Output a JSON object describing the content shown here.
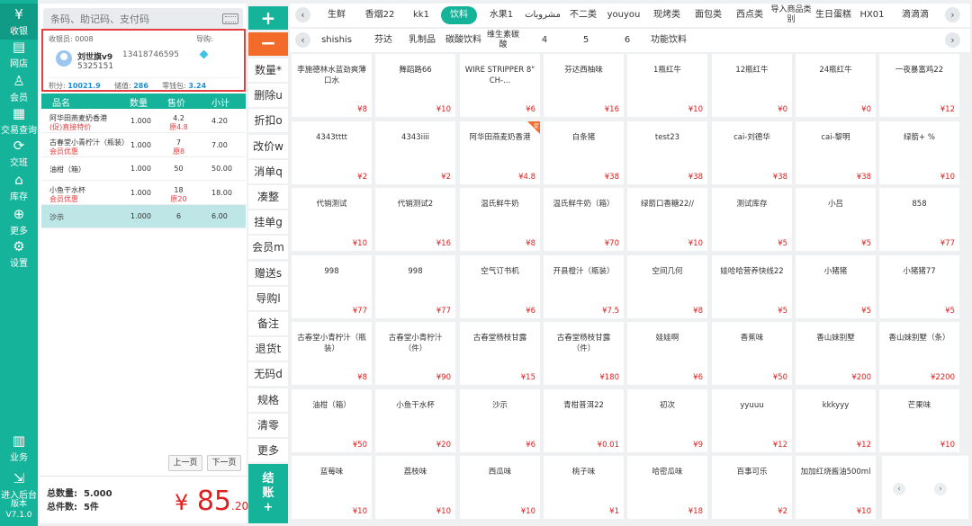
{
  "nav": {
    "items": [
      {
        "label": "收银",
        "icon": "cashier-icon",
        "glyph": "¥"
      },
      {
        "label": "网店",
        "icon": "store-icon",
        "glyph": "▤"
      },
      {
        "label": "会员",
        "icon": "member-icon",
        "glyph": "♙"
      },
      {
        "label": "交易查询",
        "icon": "transactions-icon",
        "glyph": "▦"
      },
      {
        "label": "交班",
        "icon": "shift-icon",
        "glyph": "⟳"
      },
      {
        "label": "库存",
        "icon": "inventory-icon",
        "glyph": "⌂"
      },
      {
        "label": "更多",
        "icon": "more-icon",
        "glyph": "⊕"
      },
      {
        "label": "设置",
        "icon": "settings-icon",
        "glyph": "⚙"
      },
      {
        "label": "业务",
        "icon": "business-icon",
        "glyph": "▥"
      },
      {
        "label": "进入后台",
        "icon": "backend-icon",
        "glyph": "⇲"
      }
    ],
    "version_label": "版本",
    "version": "V7.1.0"
  },
  "search": {
    "placeholder": "条码、助记码、支付码"
  },
  "member": {
    "cashier_label": "收银员: 0008",
    "guide_label": "导购:",
    "name": "刘世旗v9",
    "phone": "13418746595",
    "card": "5325151",
    "points_label": "积分:",
    "points": "10021.9",
    "balance_label": "储值:",
    "balance": "286",
    "change_label": "零钱包:",
    "change": "3.24"
  },
  "cart": {
    "headers": [
      "品名",
      "数量",
      "售价",
      "小计"
    ],
    "rows": [
      {
        "name": "阿华田燕麦奶香港",
        "sub": "(促)直接特价",
        "qty": "1.000",
        "price": "4.2",
        "orig": "原4.8",
        "sum": "4.20"
      },
      {
        "name": "古春堂小青柠汁（瓶装）",
        "sub": "会员优惠",
        "qty": "1.000",
        "price": "7",
        "orig": "原8",
        "sum": "7.00"
      },
      {
        "name": "油柑（箱）",
        "sub": "",
        "qty": "1.000",
        "price": "50",
        "orig": "",
        "sum": "50.00"
      },
      {
        "name": "小鱼干水杯",
        "sub": "会员优惠",
        "qty": "1.000",
        "price": "18",
        "orig": "原20",
        "sum": "18.00"
      },
      {
        "name": "沙示",
        "sub": "",
        "qty": "1.000",
        "price": "6",
        "orig": "",
        "sum": "6.00"
      }
    ],
    "prev_page": "上一页",
    "next_page": "下一页",
    "total_qty_label": "总数量:",
    "total_qty": "5.000",
    "total_items_label": "总件数:",
    "total_items": "5件",
    "grand_currency": "¥",
    "grand_int": "85",
    "grand_dec": ".20"
  },
  "funcs": {
    "add": "+",
    "minus": "−",
    "buttons": [
      "数量*",
      "删除u",
      "折扣o",
      "改价w",
      "消单q",
      "凑整",
      "挂单g",
      "会员m",
      "赠送s",
      "导购l",
      "备注",
      "退货t",
      "无码d",
      "规格",
      "清零",
      "更多"
    ],
    "checkout_1": "结",
    "checkout_2": "账",
    "checkout_3": "+"
  },
  "categories_row1": [
    "生鲜",
    "香烟22",
    "kk1",
    "饮料",
    "水果1",
    "مشروبات",
    "不二类",
    "youyou",
    "现烤类",
    "面包类",
    "西点类",
    "导入商品类别",
    "生日蛋糕",
    "HX01",
    "滴滴滴"
  ],
  "categories_row2": [
    "shishis",
    "芬达",
    "乳制品",
    "碳酸饮料",
    "维生素碳酸",
    "4",
    "5",
    "6",
    "功能饮料"
  ],
  "active_category": "饮料",
  "products": [
    {
      "name": "李施德林水蓝劲爽薄口水",
      "price": "¥8"
    },
    {
      "name": "舞蹈路66",
      "price": "¥10"
    },
    {
      "name": "WIRE STRIPPER 8\" CH-...",
      "price": "¥6"
    },
    {
      "name": "芬达西柚味",
      "price": "¥16"
    },
    {
      "name": "1瓶红牛",
      "price": "¥10"
    },
    {
      "name": "12瓶红牛",
      "price": "¥0"
    },
    {
      "name": "24瓶红牛",
      "price": "¥0"
    },
    {
      "name": "一夜暴富鸡22",
      "price": "¥12"
    },
    {
      "name": "4343tttt",
      "price": "¥2"
    },
    {
      "name": "4343iiii",
      "price": "¥2"
    },
    {
      "name": "阿华田燕麦奶香港",
      "price": "¥4.8",
      "badge": "促"
    },
    {
      "name": "白条猪",
      "price": "¥38"
    },
    {
      "name": "test23",
      "price": "¥38"
    },
    {
      "name": "cai-刘德华",
      "price": "¥38"
    },
    {
      "name": "cai-黎明",
      "price": "¥38"
    },
    {
      "name": "绿箭+ %",
      "price": "¥10"
    },
    {
      "name": "代销测试",
      "price": "¥10"
    },
    {
      "name": "代销测试2",
      "price": "¥16"
    },
    {
      "name": "温氏鲜牛奶",
      "price": "¥8"
    },
    {
      "name": "温氏鲜牛奶（箱）",
      "price": "¥70"
    },
    {
      "name": "绿箭口香糖22//",
      "price": "¥10"
    },
    {
      "name": "测试库存",
      "price": "¥5"
    },
    {
      "name": "小吕",
      "price": "¥5"
    },
    {
      "name": "858",
      "price": "¥77"
    },
    {
      "name": "998",
      "price": "¥77"
    },
    {
      "name": "998",
      "price": "¥77"
    },
    {
      "name": "空气订书机",
      "price": "¥6"
    },
    {
      "name": "开县橙汁（瓶装）",
      "price": "¥7.5"
    },
    {
      "name": "空间几何",
      "price": "¥8"
    },
    {
      "name": "娃哈哈营养快线22",
      "price": "¥5"
    },
    {
      "name": "小猪猪",
      "price": "¥5"
    },
    {
      "name": "小猪猪77",
      "price": "¥5"
    },
    {
      "name": "古春堂小青柠汁（瓶装）",
      "price": "¥8"
    },
    {
      "name": "古春堂小青柠汁（件）",
      "price": "¥90"
    },
    {
      "name": "古春堂杨枝甘露",
      "price": "¥15"
    },
    {
      "name": "古春堂杨枝甘露（件）",
      "price": "¥180"
    },
    {
      "name": "娃娃啊",
      "price": "¥6"
    },
    {
      "name": "香蕉味",
      "price": "¥50"
    },
    {
      "name": "香山妹别墅",
      "price": "¥200"
    },
    {
      "name": "香山妹别墅（条）",
      "price": "¥2200"
    },
    {
      "name": "油柑（箱）",
      "price": "¥50"
    },
    {
      "name": "小鱼干水杯",
      "price": "¥20"
    },
    {
      "name": "沙示",
      "price": "¥6"
    },
    {
      "name": "青柑普洱22",
      "price": "¥0.01"
    },
    {
      "name": "初次",
      "price": "¥9"
    },
    {
      "name": "yyuuu",
      "price": "¥12"
    },
    {
      "name": "kkkyyy",
      "price": "¥12"
    },
    {
      "name": "芒果味",
      "price": "¥10"
    },
    {
      "name": "蓝莓味",
      "price": "¥10"
    },
    {
      "name": "荔枝味",
      "price": "¥10"
    },
    {
      "name": "西瓜味",
      "price": "¥10"
    },
    {
      "name": "桃子味",
      "price": "¥1"
    },
    {
      "name": "哈密瓜味",
      "price": "¥18"
    },
    {
      "name": "百事可乐",
      "price": "¥2"
    },
    {
      "name": "加加红烧酱油500ml",
      "price": "¥10"
    }
  ],
  "colors": {
    "accent": "#14b39a",
    "danger": "#e02020",
    "orange": "#f26b2b"
  }
}
